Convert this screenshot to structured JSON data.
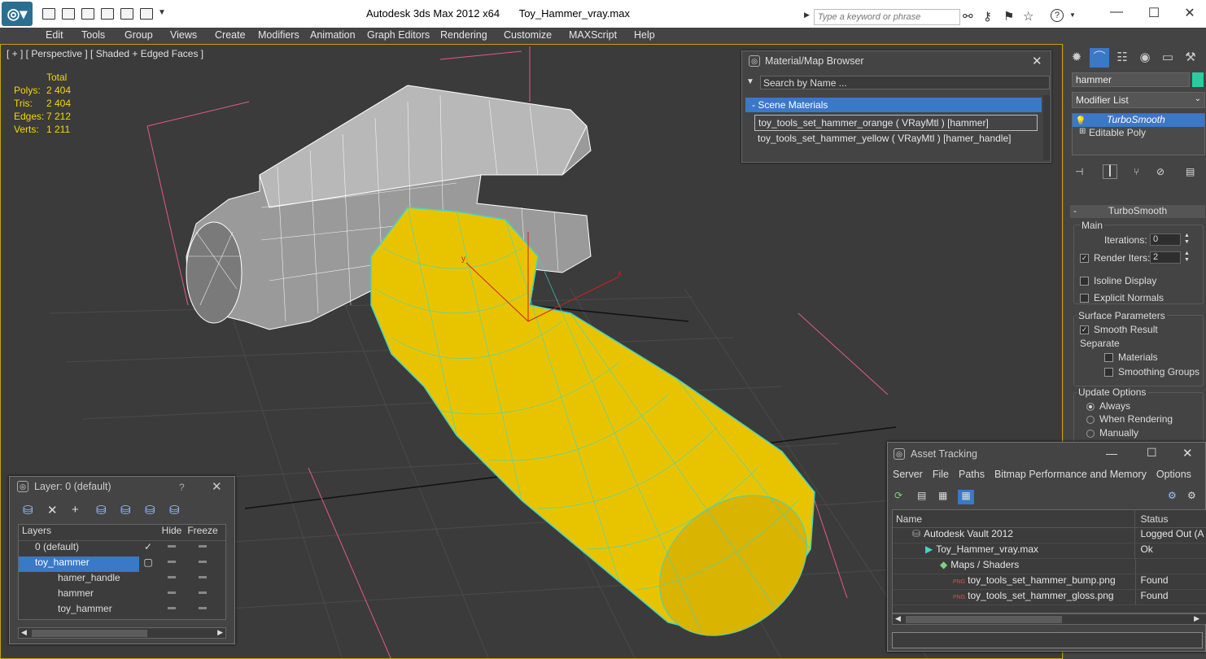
{
  "titlebar": {
    "app_title": "Autodesk 3ds Max  2012 x64",
    "file_name": "Toy_Hammer_vray.max",
    "search_placeholder": "Type a keyword or phrase",
    "help_label": "?"
  },
  "menu": [
    "Edit",
    "Tools",
    "Group",
    "Views",
    "Create",
    "Modifiers",
    "Animation",
    "Graph Editors",
    "Rendering",
    "Customize",
    "MAXScript",
    "Help"
  ],
  "viewport": {
    "label": "[ + ] [ Perspective ] [ Shaded + Edged Faces ]",
    "stats_header": "Total",
    "stats": [
      {
        "label": "Polys:",
        "value": "2 404"
      },
      {
        "label": "Tris:",
        "value": "2 404"
      },
      {
        "label": "Edges:",
        "value": "7 212"
      },
      {
        "label": "Verts:",
        "value": "1 211"
      }
    ],
    "axis_y": "y",
    "axis_x": "x"
  },
  "command_panel": {
    "object_name": "hammer",
    "object_color": "#2ec9a0",
    "modifier_list": "Modifier List",
    "stack": [
      "TurboSmooth",
      "Editable Poly"
    ],
    "rollout_title": "TurboSmooth",
    "main_label": "Main",
    "iterations_label": "Iterations:",
    "iterations_value": "0",
    "render_iters_label": "Render Iters:",
    "render_iters_value": "2",
    "isoline_label": "Isoline Display",
    "explicit_normals_label": "Explicit Normals",
    "surface_params_label": "Surface Parameters",
    "smooth_result_label": "Smooth Result",
    "separate_label": "Separate",
    "materials_label": "Materials",
    "smoothing_groups_label": "Smoothing Groups",
    "update_options_label": "Update Options",
    "always_label": "Always",
    "when_rendering_label": "When Rendering",
    "manually_label": "Manually"
  },
  "material_browser": {
    "title": "Material/Map Browser",
    "search_placeholder": "Search by Name ...",
    "group_label": "Scene Materials",
    "materials": [
      "toy_tools_set_hammer_orange  ( VRayMtl )  [hammer]",
      "toy_tools_set_hammer_yellow  ( VRayMtl )  [hamer_handle]"
    ]
  },
  "layer_dialog": {
    "title": "Layer: 0 (default)",
    "help": "?",
    "col_layers": "Layers",
    "col_hide": "Hide",
    "col_freeze": "Freeze",
    "rows": [
      "0 (default)",
      "toy_hammer",
      "hamer_handle",
      "hammer",
      "toy_hammer"
    ]
  },
  "asset_tracking": {
    "title": "Asset Tracking",
    "menu": [
      "Server",
      "File",
      "Paths",
      "Bitmap Performance and Memory",
      "Options"
    ],
    "col_name": "Name",
    "col_status": "Status",
    "rows": [
      {
        "name": "Autodesk Vault 2012",
        "status": "Logged Out (A"
      },
      {
        "name": "Toy_Hammer_vray.max",
        "status": "Ok"
      },
      {
        "name": "Maps / Shaders",
        "status": ""
      },
      {
        "name": "toy_tools_set_hammer_bump.png",
        "status": "Found"
      },
      {
        "name": "toy_tools_set_hammer_gloss.png",
        "status": "Found"
      }
    ],
    "png_badge": "PNG"
  },
  "colors": {
    "viewport_border": "#c8a000",
    "selection_blue": "#3a78c8",
    "stats_yellow": "#f5d800",
    "handle_yellow": "#e8c400",
    "wire_cyan": "#3fd6c4"
  }
}
